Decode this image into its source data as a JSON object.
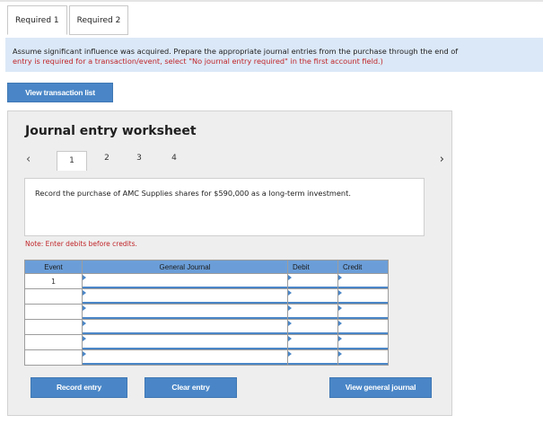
{
  "tabs": [
    {
      "label": "Required 1",
      "active": true
    },
    {
      "label": "Required 2",
      "active": false
    }
  ],
  "instructions": {
    "line1": "Assume significant influence was acquired. Prepare the appropriate journal entries from the purchase through the end of",
    "line2": "entry is required for a transaction/event, select \"No journal entry required\" in the first account field.)"
  },
  "buttons": {
    "view_transaction_list": "View transaction list",
    "record_entry": "Record entry",
    "clear_entry": "Clear entry",
    "view_general_journal": "View general journal"
  },
  "worksheet": {
    "title": "Journal entry worksheet",
    "pages": [
      "1",
      "2",
      "3",
      "4"
    ],
    "active_page": "1",
    "prev_icon": "chevron-left-icon",
    "next_icon": "chevron-right-icon",
    "description": "Record the purchase of AMC Supplies shares for $590,000 as a long-term investment.",
    "note": "Note: Enter debits before credits."
  },
  "table": {
    "headers": {
      "event": "Event",
      "general_journal": "General Journal",
      "debit": "Debit",
      "credit": "Credit"
    },
    "rows": [
      {
        "event": "1"
      },
      {
        "event": ""
      },
      {
        "event": ""
      },
      {
        "event": ""
      },
      {
        "event": ""
      },
      {
        "event": ""
      }
    ]
  },
  "colors": {
    "accent": "#4a86c7",
    "header_blue": "#6b9ed8",
    "instruction_bg": "#dbe8f7",
    "warning_red": "#c0262a"
  }
}
